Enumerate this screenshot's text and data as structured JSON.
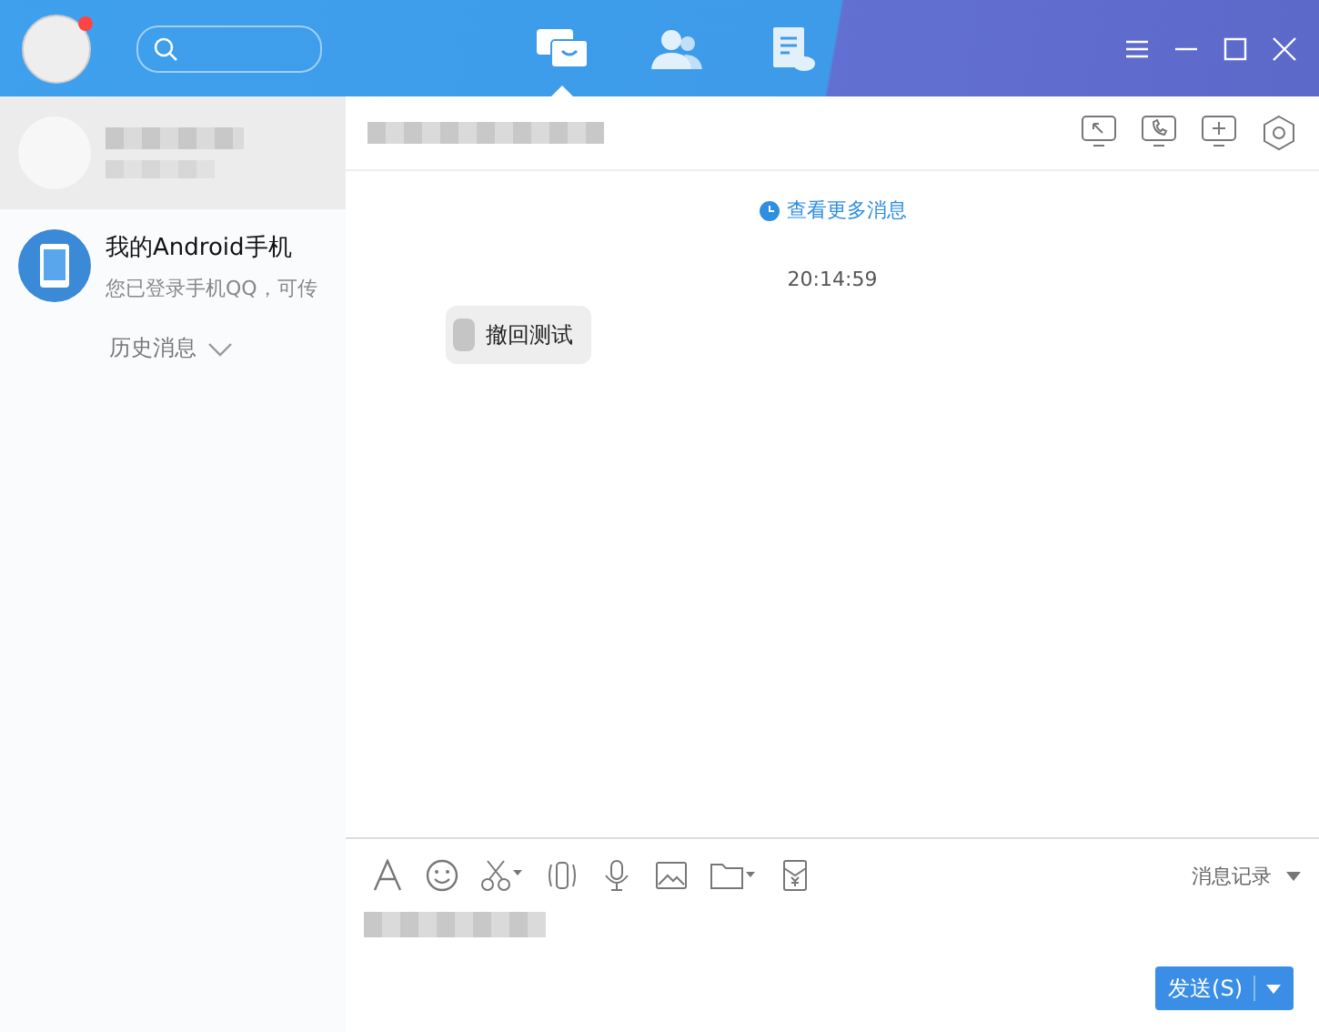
{
  "header": {
    "avatar_badge": true,
    "tabs": [
      {
        "kind": "chats",
        "selected": true
      },
      {
        "kind": "contacts",
        "selected": false
      },
      {
        "kind": "files",
        "selected": false
      }
    ]
  },
  "contacts": [
    {
      "kind": "blurred",
      "selected": true
    },
    {
      "kind": "device",
      "selected": false,
      "name": "我的Android手机",
      "preview": "您已登录手机QQ，可传"
    }
  ],
  "history_toggle": {
    "label": "历史消息",
    "expanded": false
  },
  "chat": {
    "more_link": "查看更多消息",
    "time": "20:14:59",
    "messages": [
      {
        "text": "撤回测试"
      }
    ]
  },
  "composer": {
    "history_label": "消息记录",
    "send_label": "发送(S)"
  }
}
